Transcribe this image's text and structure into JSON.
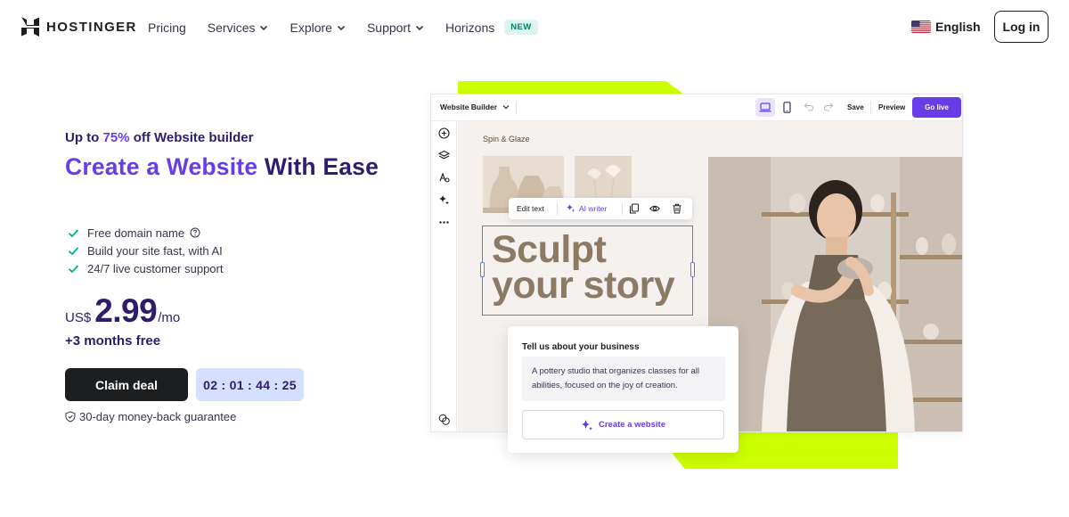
{
  "brand": {
    "name": "HOSTINGER"
  },
  "nav": {
    "items": [
      {
        "label": "Pricing"
      },
      {
        "label": "Services"
      },
      {
        "label": "Explore"
      },
      {
        "label": "Support"
      },
      {
        "label": "Horizons"
      }
    ],
    "new_badge": "NEW"
  },
  "language": {
    "label": "English",
    "icon": "us-flag-icon"
  },
  "login": {
    "label": "Log in"
  },
  "hero": {
    "promo_prefix": "Up to ",
    "promo_pct": "75%",
    "promo_suffix": " off Website builder",
    "title_accent": "Create a Website",
    "title_rest": " With Ease",
    "features": [
      {
        "label": "Free domain name"
      },
      {
        "label": "Build your site fast, with AI"
      },
      {
        "label": "24/7 live customer support"
      }
    ],
    "currency": "US$",
    "price": "2.99",
    "per": "/mo",
    "bonus": "+3 months free",
    "claim_label": "Claim deal",
    "timer": "02 : 01 : 44 : 25",
    "guarantee": "30-day money-back guarantee"
  },
  "builder": {
    "select_label": "Website Builder",
    "save": "Save",
    "preview": "Preview",
    "go_live": "Go live",
    "brand_label": "Spin & Glaze",
    "edit_text": "Edit text",
    "ai_writer": "AI writer",
    "headline_line1": "Sculpt",
    "headline_line2": "your story"
  },
  "business_card": {
    "title": "Tell us about your business",
    "description": "A pottery studio that organizes classes for all abilities, focused on the joy of creation.",
    "button": "Create a website"
  },
  "colors": {
    "accent": "#673de6",
    "navy": "#2f1c6a",
    "lime": "#cdff00",
    "timer_bg": "#d5dfff",
    "check": "#00b090"
  }
}
